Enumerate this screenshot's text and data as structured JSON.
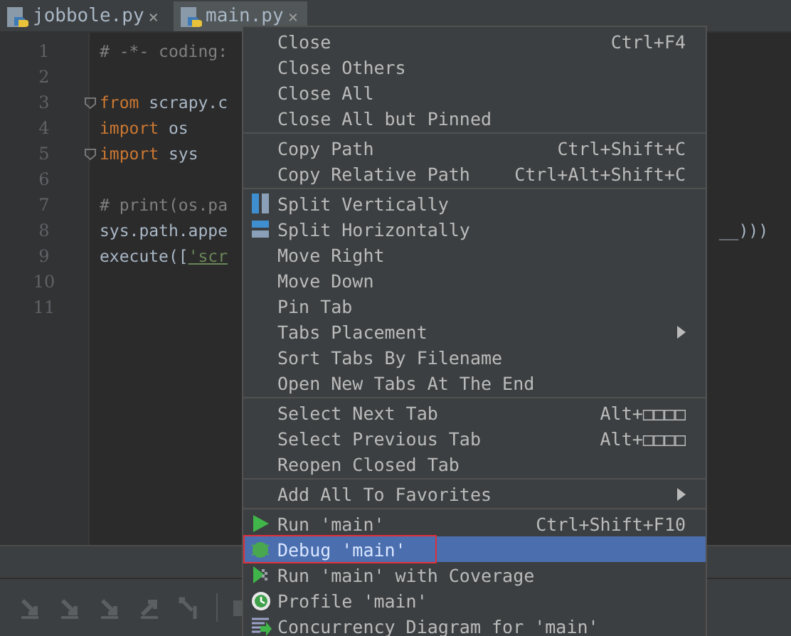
{
  "tabs": [
    {
      "label": "jobbole.py",
      "close": "×",
      "selected": false
    },
    {
      "label": "main.py",
      "close": "×",
      "selected": true
    }
  ],
  "editor": {
    "line_numbers": [
      "1",
      "2",
      "3",
      "4",
      "5",
      "6",
      "7",
      "8",
      "9",
      "10",
      "11"
    ],
    "lines": [
      {
        "tokens": [
          {
            "kind": "comment",
            "text": "# -*- coding:"
          }
        ]
      },
      {
        "fold": false
      },
      {
        "fold": true,
        "tokens": [
          {
            "kind": "keyword",
            "text": "from"
          },
          {
            "kind": "plain",
            "text": " scrapy.c"
          }
        ]
      },
      {
        "fold": false,
        "tokens": [
          {
            "kind": "keyword",
            "text": "import"
          },
          {
            "kind": "plain",
            "text": " os"
          }
        ]
      },
      {
        "fold": true,
        "tokens": [
          {
            "kind": "keyword",
            "text": "import"
          },
          {
            "kind": "plain",
            "text": " sys"
          }
        ]
      },
      {
        "fold": false
      },
      {
        "tokens": [
          {
            "kind": "comment",
            "text": "# print(os.pa"
          }
        ]
      },
      {
        "tokens": [
          {
            "kind": "plain",
            "text": "sys.path.appe"
          }
        ],
        "tail": "__)))"
      },
      {
        "tokens": [
          {
            "kind": "plain",
            "text": "execute(["
          },
          {
            "kind": "string",
            "text": "'scr"
          }
        ]
      },
      {
        "fold": false
      },
      {
        "fold": false
      }
    ]
  },
  "menu": {
    "groups": [
      [
        {
          "label": "Close",
          "shortcut": "Ctrl+F4",
          "kind": "plain",
          "submenu": false,
          "selected": false,
          "outlined": false
        },
        {
          "label": "Close Others",
          "kind": "plain",
          "submenu": false,
          "selected": false,
          "outlined": false
        },
        {
          "label": "Close All",
          "kind": "plain",
          "submenu": false,
          "selected": false,
          "outlined": false
        },
        {
          "label": "Close All but Pinned",
          "kind": "plain",
          "submenu": false,
          "selected": false,
          "outlined": false
        }
      ],
      [
        {
          "label": "Copy Path",
          "shortcut": "Ctrl+Shift+C",
          "kind": "plain",
          "submenu": false,
          "selected": false,
          "outlined": false
        },
        {
          "label": "Copy Relative Path",
          "shortcut": "Ctrl+Alt+Shift+C",
          "kind": "plain",
          "submenu": false,
          "selected": false,
          "outlined": false
        }
      ],
      [
        {
          "label": "Split Vertically",
          "kind": "vsplit",
          "submenu": false,
          "selected": false,
          "outlined": false
        },
        {
          "label": "Split Horizontally",
          "kind": "hsplit",
          "submenu": false,
          "selected": false,
          "outlined": false
        },
        {
          "label": "Move Right",
          "kind": "plain",
          "submenu": false,
          "selected": false,
          "outlined": false
        },
        {
          "label": "Move Down",
          "kind": "plain",
          "submenu": false,
          "selected": false,
          "outlined": false
        },
        {
          "label": "Pin Tab",
          "kind": "plain",
          "submenu": false,
          "selected": false,
          "outlined": false
        },
        {
          "label": "Tabs Placement",
          "kind": "plain",
          "submenu": true,
          "selected": false,
          "outlined": false
        },
        {
          "label": "Sort Tabs By Filename",
          "kind": "plain",
          "submenu": false,
          "selected": false,
          "outlined": false
        },
        {
          "label": "Open New Tabs At The End",
          "kind": "plain",
          "submenu": false,
          "selected": false,
          "outlined": false
        }
      ],
      [
        {
          "label": "Select Next Tab",
          "shortcut": "Alt+□□□□",
          "kind": "plain",
          "submenu": false,
          "selected": false,
          "outlined": false
        },
        {
          "label": "Select Previous Tab",
          "shortcut": "Alt+□□□□",
          "kind": "plain",
          "submenu": false,
          "selected": false,
          "outlined": false
        },
        {
          "label": "Reopen Closed Tab",
          "kind": "plain",
          "submenu": false,
          "selected": false,
          "outlined": false
        }
      ],
      [
        {
          "label": "Add All To Favorites",
          "kind": "plain",
          "submenu": true,
          "selected": false,
          "outlined": false
        }
      ],
      [
        {
          "label": "Run 'main'",
          "shortcut": "Ctrl+Shift+F10",
          "kind": "run",
          "submenu": false,
          "selected": false,
          "outlined": false
        },
        {
          "label": "Debug 'main'",
          "kind": "debug",
          "submenu": false,
          "selected": true,
          "outlined": true
        },
        {
          "label": "Run 'main' with Coverage",
          "kind": "coverage",
          "submenu": false,
          "selected": false,
          "outlined": false
        },
        {
          "label": "Profile 'main'",
          "kind": "profile",
          "submenu": false,
          "selected": false,
          "outlined": false
        },
        {
          "label": "Concurrency Diagram for  'main'",
          "kind": "concurrency",
          "submenu": false,
          "selected": false,
          "outlined": false
        }
      ]
    ]
  }
}
